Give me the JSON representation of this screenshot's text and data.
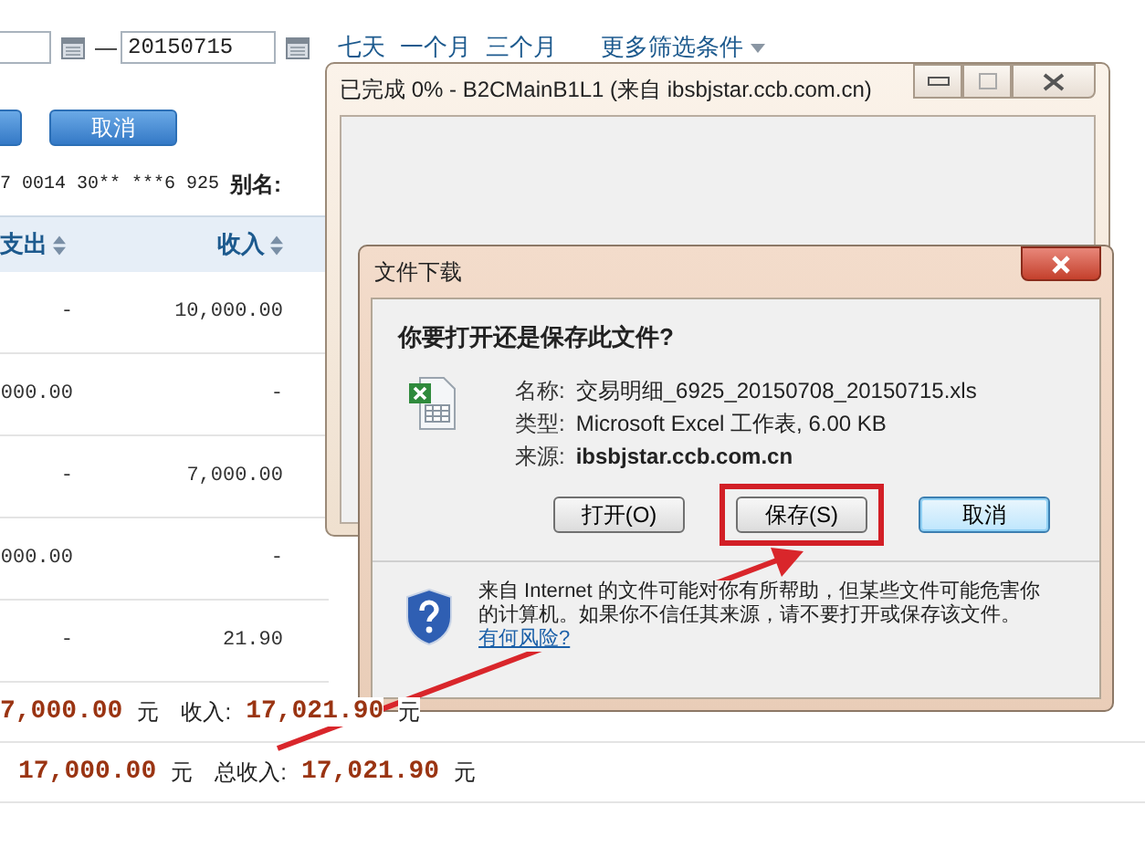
{
  "filter": {
    "date_separator": "—",
    "date_to": "20150715",
    "quick_ranges": [
      "七天",
      "一个月",
      "三个月"
    ],
    "more_filters": "更多筛选条件"
  },
  "actions": {
    "cancel": "取消"
  },
  "account": {
    "number": "7 0014 30** ***6 925",
    "alias_label": "别名:"
  },
  "table": {
    "columns": [
      "支出",
      "收入"
    ],
    "rows": [
      {
        "expense": "-",
        "income": "10,000.00"
      },
      {
        "expense": "000.00",
        "income": "-"
      },
      {
        "expense": "-",
        "income": "7,000.00"
      },
      {
        "expense": "000.00",
        "income": "-"
      },
      {
        "expense": "-",
        "income": "21.90"
      }
    ]
  },
  "summary": [
    [
      {
        "kind": "amount",
        "text": "7,000.00"
      },
      {
        "kind": "unit",
        "text": "元"
      },
      {
        "kind": "label",
        "text": "收入:"
      },
      {
        "kind": "amount",
        "text": "17,021.90"
      },
      {
        "kind": "unit",
        "text": "元"
      }
    ],
    [
      {
        "kind": "amount",
        "text": "17,000.00"
      },
      {
        "kind": "unit",
        "text": "元"
      },
      {
        "kind": "label",
        "text": "总收入:"
      },
      {
        "kind": "amount",
        "text": "17,021.90"
      },
      {
        "kind": "unit",
        "text": "元"
      }
    ]
  ],
  "progress_window": {
    "title": "已完成 0% - B2CMainB1L1 (来自 ibsbjstar.ccb.com.cn)"
  },
  "download_dialog": {
    "title": "文件下载",
    "question": "你要打开还是保存此文件?",
    "fields": [
      {
        "label": "名称:",
        "value": "交易明细_6925_20150708_20150715.xls",
        "emphasis": false
      },
      {
        "label": "类型:",
        "value": "Microsoft Excel 工作表, 6.00 KB",
        "emphasis": false
      },
      {
        "label": "来源:",
        "value": "ibsbjstar.ccb.com.cn",
        "emphasis": true
      }
    ],
    "buttons": [
      {
        "label": "打开(O)",
        "focused": false,
        "annotated": false
      },
      {
        "label": "保存(S)",
        "focused": false,
        "annotated": true
      },
      {
        "label": "取消",
        "focused": true,
        "annotated": false
      }
    ],
    "warning": {
      "text": "来自 Internet 的文件可能对你有所帮助，但某些文件可能危害你的计算机。如果你不信任其来源，请不要打开或保存该文件。",
      "link": "有何风险?"
    }
  }
}
